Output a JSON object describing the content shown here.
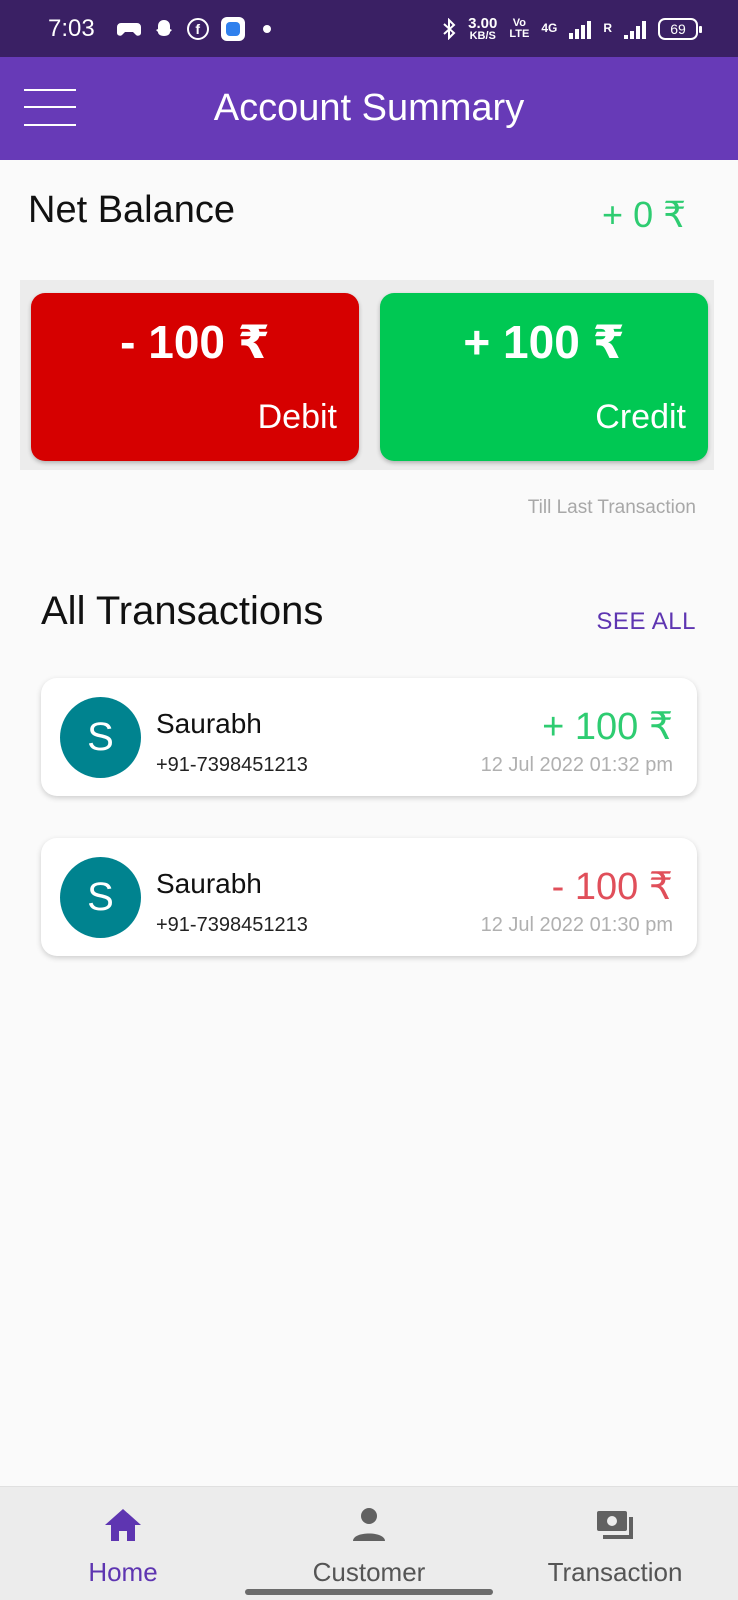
{
  "status_bar": {
    "time": "7:03",
    "speed_value": "3.00",
    "speed_unit": "KB/S",
    "volte_top": "Vo",
    "volte_bottom": "LTE",
    "network": "4G",
    "roaming": "R",
    "battery": "69"
  },
  "header": {
    "title": "Account Summary"
  },
  "net_balance": {
    "label": "Net Balance",
    "value": "+ 0 ₹"
  },
  "summary": {
    "debit": {
      "amount": "- 100 ₹",
      "label": "Debit"
    },
    "credit": {
      "amount": "+ 100 ₹",
      "label": "Credit"
    },
    "footnote": "Till Last Transaction"
  },
  "transactions": {
    "title": "All Transactions",
    "see_all": "SEE ALL",
    "items": [
      {
        "initial": "S",
        "name": "Saurabh",
        "phone": "+91-7398451213",
        "amount": "+ 100 ₹",
        "type": "credit",
        "datetime": "12 Jul 2022 01:32 pm"
      },
      {
        "initial": "S",
        "name": "Saurabh",
        "phone": "+91-7398451213",
        "amount": "- 100 ₹",
        "type": "debit",
        "datetime": "12 Jul 2022 01:30 pm"
      }
    ]
  },
  "bottom_nav": {
    "items": [
      {
        "label": "Home",
        "icon": "home-icon",
        "active": true
      },
      {
        "label": "Customer",
        "icon": "person-icon",
        "active": false
      },
      {
        "label": "Transaction",
        "icon": "money-icon",
        "active": false
      }
    ]
  },
  "colors": {
    "status_bar": "#3a2064",
    "app_bar": "#673ab7",
    "debit": "#d60000",
    "credit": "#00c853",
    "positive_text": "#2ecc71",
    "negative_text": "#e04f5a",
    "avatar": "#00838f",
    "accent": "#5e35b1"
  }
}
